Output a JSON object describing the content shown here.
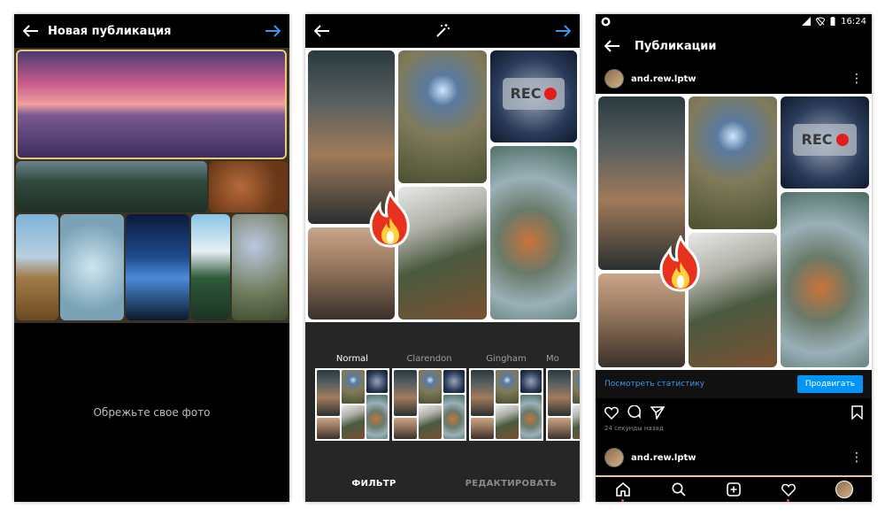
{
  "screen1": {
    "title": "Новая публикация",
    "crop_hint": "Обрежьте свое фото"
  },
  "screen2": {
    "filters": [
      {
        "name": "Normal",
        "active": true
      },
      {
        "name": "Clarendon",
        "active": false
      },
      {
        "name": "Gingham",
        "active": false
      },
      {
        "name": "Mo",
        "active": false
      }
    ],
    "tabs": {
      "filter": "ФИЛЬТР",
      "edit": "РЕДАКТИРОВАТЬ"
    }
  },
  "screen3": {
    "status": {
      "time": "16:24"
    },
    "title": "Публикации",
    "username": "and.rew.lptw",
    "stats_link": "Посмотреть статистику",
    "promote_button": "Продвигать",
    "time_ago": "24 секунды назад",
    "next_username": "and.rew.lptw"
  },
  "collage_badge": "REC",
  "colors": {
    "accent_blue": "#3897f0",
    "promote_blue": "#0095f6",
    "notification_red": "#ed4956"
  }
}
